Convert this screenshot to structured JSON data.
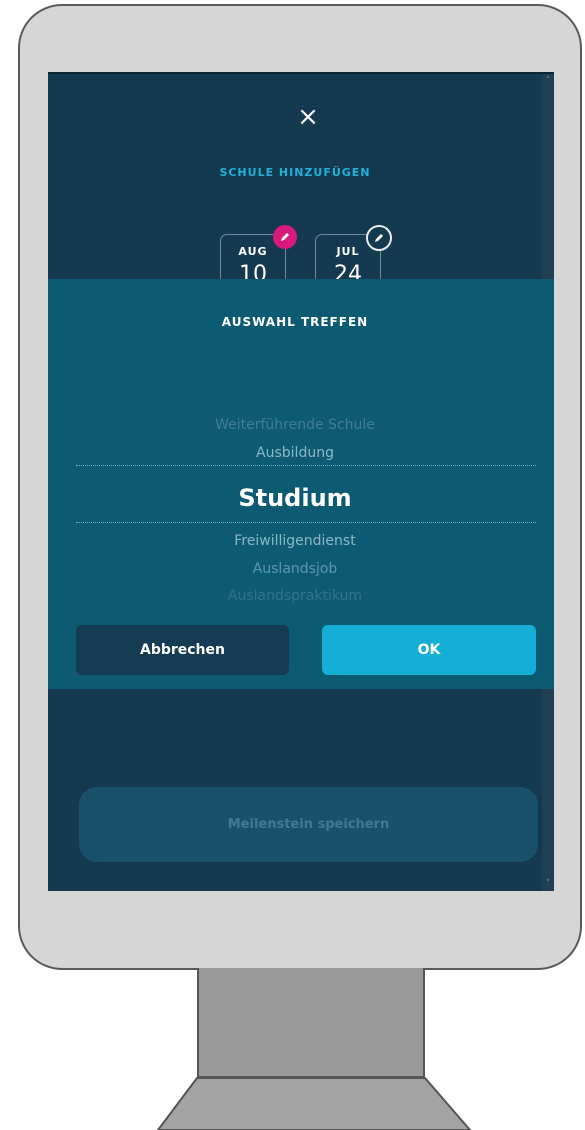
{
  "dialog": {
    "close_glyph": "×",
    "title": "SCHULE HINZUFÜGEN"
  },
  "dates": {
    "start": {
      "month": "AUG",
      "day": "10"
    },
    "end": {
      "month": "JUL",
      "day": "24"
    }
  },
  "picker": {
    "title": "AUSWAHL TREFFEN",
    "options": [
      "Weiterführende Schule",
      "Ausbildung",
      "Studium",
      "Freiwilligendienst",
      "Auslandsjob",
      "Auslandspraktikum"
    ],
    "selected": "Studium",
    "cancel_label": "Abbrechen",
    "ok_label": "OK"
  },
  "footer": {
    "save_label": "Meilenstein speichern"
  },
  "colors": {
    "accent": "#15afd5",
    "picker_bg": "#0d5b73",
    "screen_bg": "#15394e",
    "edit_badge_pink": "#d81b7a"
  }
}
